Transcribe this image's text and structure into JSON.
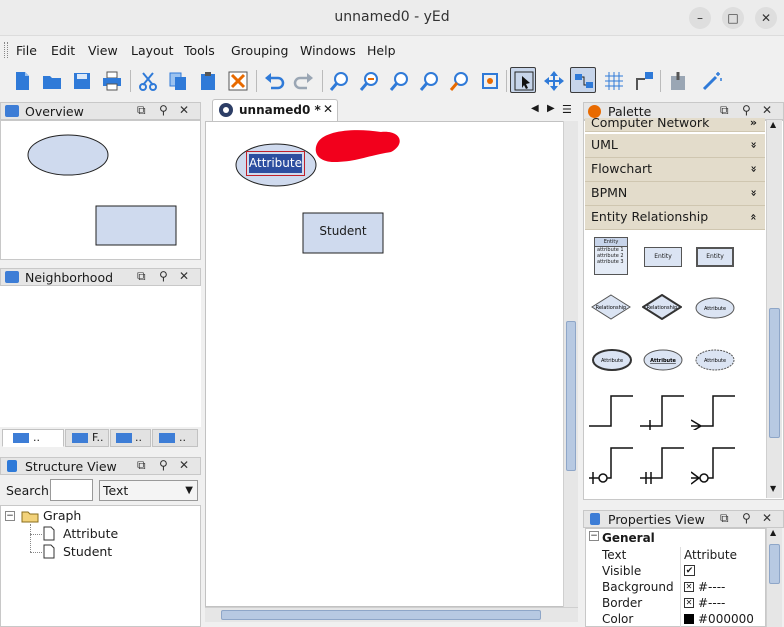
{
  "window": {
    "title": "unnamed0 - yEd"
  },
  "menu": [
    "File",
    "Edit",
    "View",
    "Layout",
    "Tools",
    "Grouping",
    "Windows",
    "Help"
  ],
  "panels": {
    "overview": "Overview",
    "neighborhood": "Neighborhood",
    "structure": "Structure View",
    "palette": "Palette",
    "properties": "Properties View"
  },
  "bottom_tabs": [
    "..",
    "F..",
    "..",
    ".."
  ],
  "structure": {
    "search_label": "Search",
    "search_value": "",
    "filter_value": "Text",
    "tree_root": "Graph",
    "tree_items": [
      "Attribute",
      "Student"
    ]
  },
  "document_tab": {
    "label": "unnamed0 *"
  },
  "canvas": {
    "nodes": {
      "attribute": "Attribute",
      "student": "Student"
    }
  },
  "palette": {
    "cut_section": "Computer Network",
    "sections": [
      "UML",
      "Flowchart",
      "BPMN",
      "Entity Relationship"
    ],
    "entity_items": {
      "entity_title": "Entity",
      "entity_attrs": [
        "attribute 1",
        "attribute 2",
        "attribute 3"
      ],
      "entity": "Entity",
      "relationship": "Relationship",
      "attribute": "Attribute"
    }
  },
  "properties": {
    "group": "General",
    "rows": [
      {
        "key": "Text",
        "value": "Attribute"
      },
      {
        "key": "Visible",
        "value": "✔"
      },
      {
        "key": "Background",
        "value": "#----"
      },
      {
        "key": "Border",
        "value": "#----"
      },
      {
        "key": "Color",
        "value": "#000000"
      }
    ]
  },
  "colors": {
    "accent": "#3d7dd6",
    "node_fill": "#cfdaee",
    "highlight": "#e8001a"
  }
}
